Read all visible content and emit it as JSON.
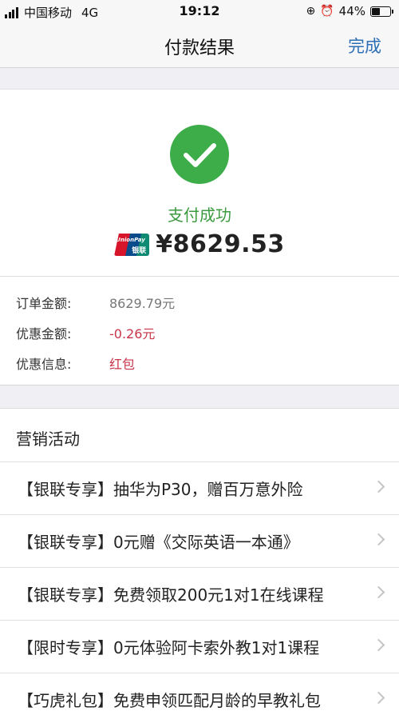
{
  "status_bar": {
    "carrier": "中国移动",
    "network": "4G",
    "time": "19:12",
    "battery": "44%",
    "battery_level": 0.44
  },
  "nav": {
    "title": "付款结果",
    "done_label": "完成"
  },
  "result": {
    "status_text": "支付成功",
    "card_brand": "UnionPay 银联",
    "amount": "¥8629.53",
    "success_color": "#3cad48"
  },
  "details": [
    {
      "label": "订单金额:",
      "value": "8629.79元"
    },
    {
      "label": "优惠金额:",
      "value": "-0.26元"
    },
    {
      "label": "优惠信息:",
      "value": "红包"
    }
  ],
  "marketing": {
    "title": "营销活动",
    "items": [
      {
        "text": "【银联专享】抽华为P30，赠百万意外险"
      },
      {
        "text": "【银联专享】0元赠《交际英语一本通》"
      },
      {
        "text": "【银联专享】免费领取200元1对1在线课程"
      },
      {
        "text": "【限时专享】0元体验阿卡索外教1对1课程"
      },
      {
        "text": "【巧虎礼包】免费申领匹配月龄的早教礼包"
      }
    ]
  },
  "colors": {
    "accent": "#2d6fb6",
    "discount_red": "#c8364a"
  }
}
